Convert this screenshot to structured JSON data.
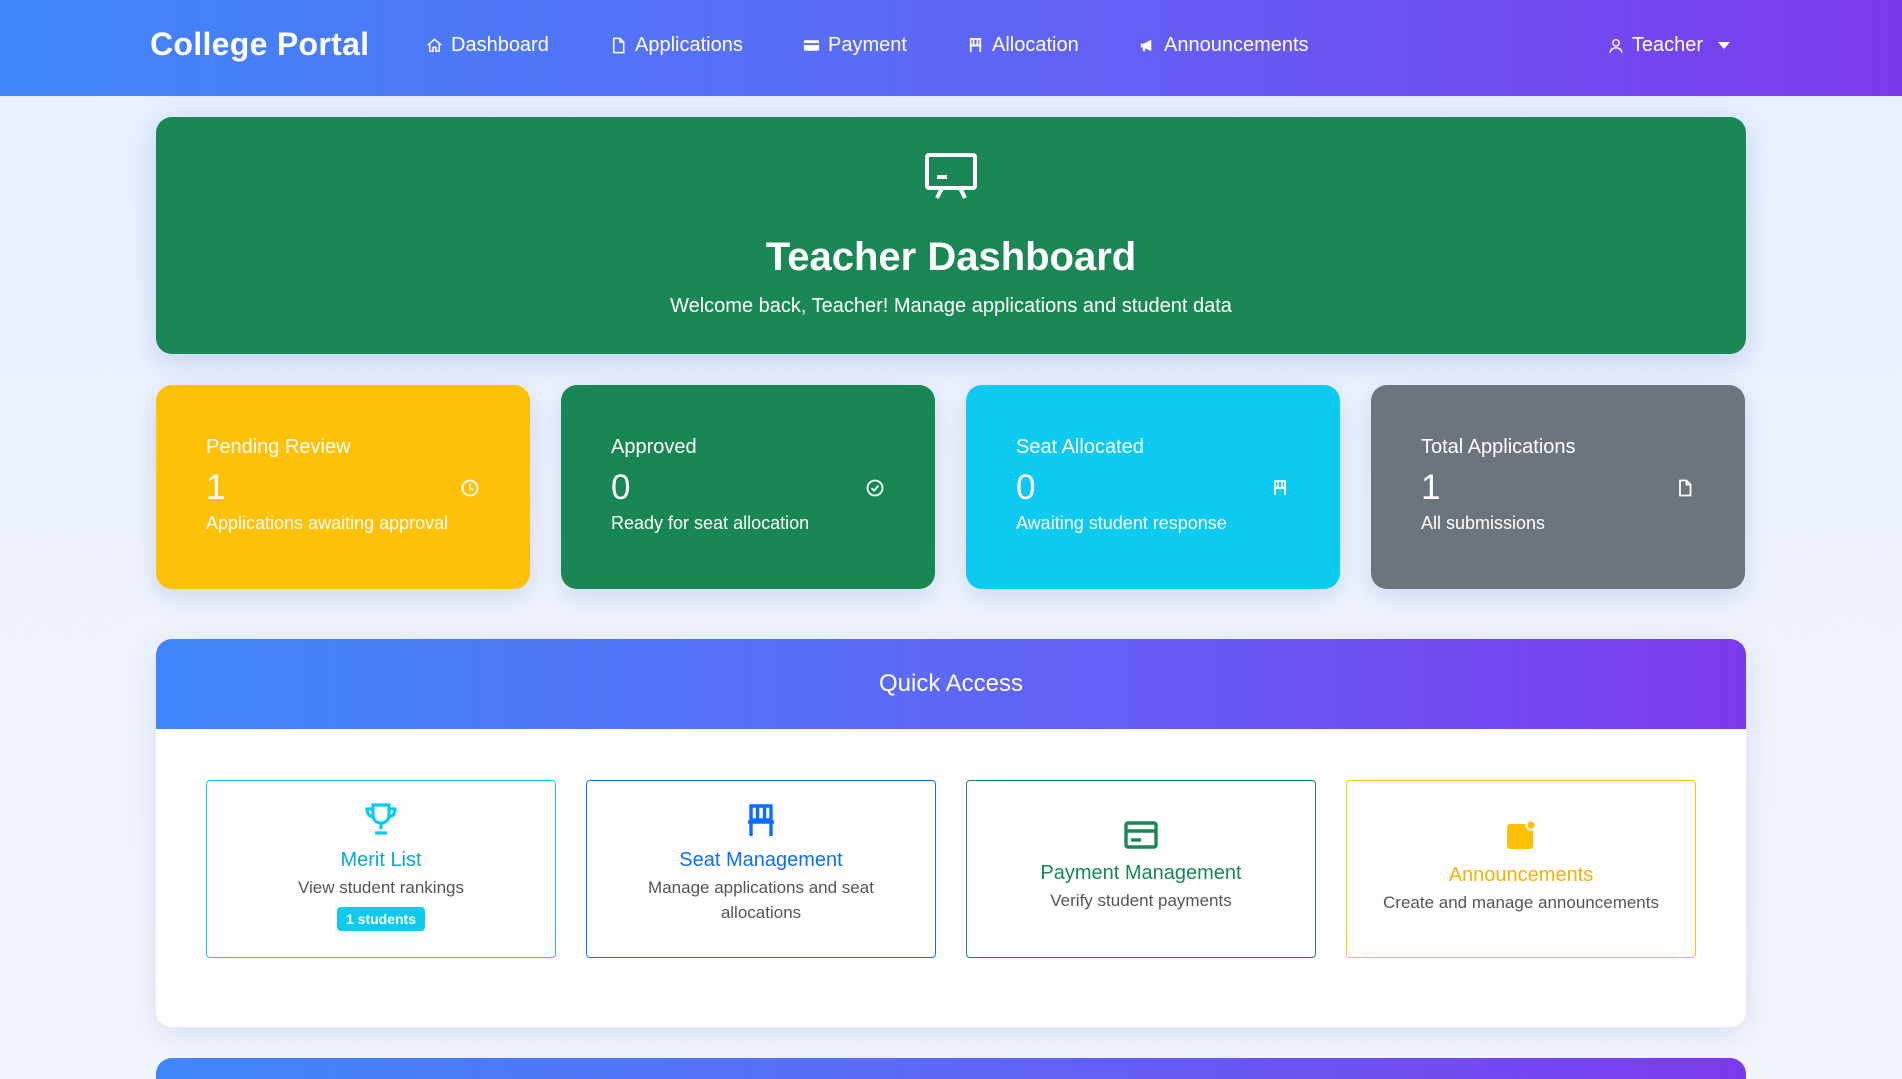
{
  "navbar": {
    "brand": "College Portal",
    "items": [
      {
        "label": "Dashboard",
        "icon": "home-icon"
      },
      {
        "label": "Applications",
        "icon": "file-icon"
      },
      {
        "label": "Payment",
        "icon": "credit-card-icon"
      },
      {
        "label": "Allocation",
        "icon": "chair-icon"
      },
      {
        "label": "Announcements",
        "icon": "megaphone-icon"
      }
    ],
    "user": {
      "label": "Teacher",
      "icon": "person-icon"
    }
  },
  "hero": {
    "icon": "presentation-board-icon",
    "title": "Teacher Dashboard",
    "subtitle": "Welcome back, Teacher! Manage applications and student data"
  },
  "stats": [
    {
      "label": "Pending Review",
      "value": "1",
      "desc": "Applications awaiting approval",
      "icon": "clock-icon",
      "color": "#ffc107"
    },
    {
      "label": "Approved",
      "value": "0",
      "desc": "Ready for seat allocation",
      "icon": "check-circle-icon",
      "color": "#198754"
    },
    {
      "label": "Seat Allocated",
      "value": "0",
      "desc": "Awaiting student response",
      "icon": "chair-icon",
      "color": "#0dcaf0"
    },
    {
      "label": "Total Applications",
      "value": "1",
      "desc": "All submissions",
      "icon": "file-icon",
      "color": "#6c757d"
    }
  ],
  "quick_access": {
    "title": "Quick Access",
    "tiles": [
      {
        "title": "Merit List",
        "desc": "View student rankings",
        "badge": "1 students",
        "icon": "trophy-icon",
        "color": "#0dcaf0"
      },
      {
        "title": "Seat Management",
        "desc": "Manage applications and seat allocations",
        "icon": "chair-icon",
        "color": "#0d6efd"
      },
      {
        "title": "Payment Management",
        "desc": "Verify student payments",
        "icon": "credit-card-icon",
        "color": "#198754"
      },
      {
        "title": "Announcements",
        "desc": "Create and manage announcements",
        "icon": "announcement-icon",
        "color": "#ffc107"
      }
    ]
  },
  "colors": {
    "nav_gradient_start": "#3f86fb",
    "nav_gradient_end": "#7c3aed",
    "hero_bg": "#1b8754"
  }
}
